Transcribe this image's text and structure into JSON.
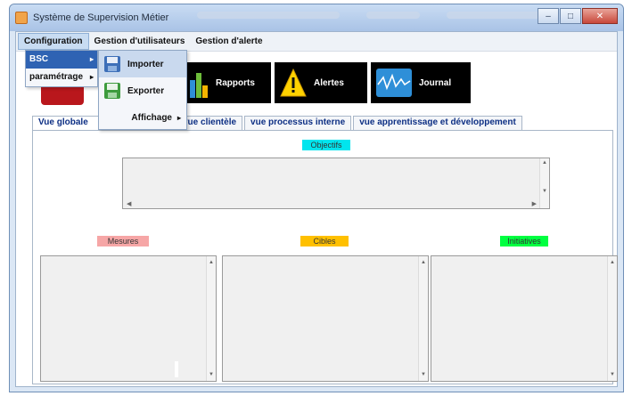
{
  "window": {
    "title": "Système de Supervision Métier",
    "min": "–",
    "max": "□",
    "close": "✕"
  },
  "menubar": {
    "items": [
      "Configuration",
      "Gestion d'utilisateurs",
      "Gestion d'alerte"
    ]
  },
  "dropdown": {
    "items": [
      "BSC",
      "paramétrage"
    ],
    "arrow": "▸"
  },
  "submenu": {
    "items": [
      "Importer",
      "Exporter",
      "Affichage"
    ],
    "arrow": "▸"
  },
  "toolbar": {
    "buttons": [
      "Rapports",
      "Alertes",
      "Journal"
    ]
  },
  "tabs": [
    "Vue globale",
    "vue clientèle",
    "vue processus interne",
    "vue  apprentissage et développement"
  ],
  "sections": {
    "objectifs": "Objectifs",
    "mesures": "Mesures",
    "cibles": "Cibles",
    "initiatives": "Initiatives"
  },
  "colors": {
    "objectifs": "#00e5ee",
    "mesures": "#f6a6a6",
    "cibles": "#ffc000",
    "initiatives": "#00ff40"
  },
  "icons": {
    "app": "house-icon",
    "importer": "disk-icon",
    "exporter": "disk-export-icon",
    "rapports": "bar-chart-icon",
    "alertes": "warning-icon",
    "journal": "wave-icon"
  }
}
